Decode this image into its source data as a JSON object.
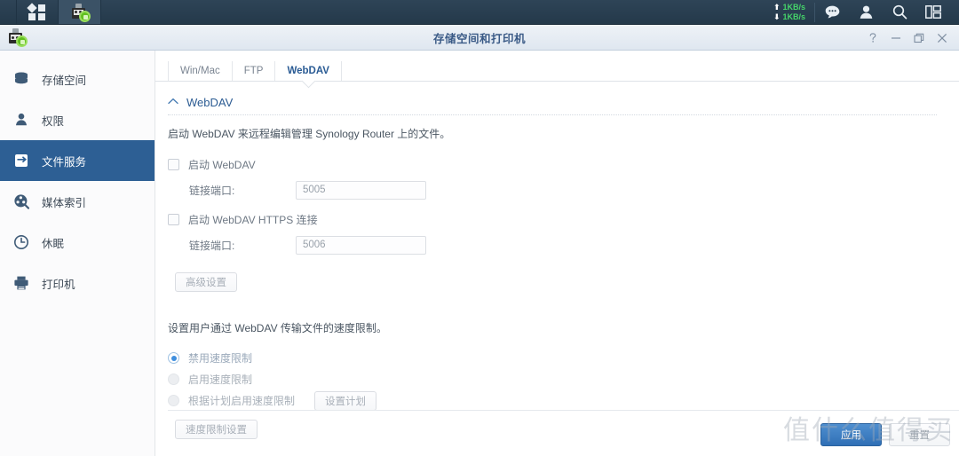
{
  "taskbar": {
    "main_menu_icon": "grid-menu-icon",
    "active_app_icon": "usb-storage-icon",
    "network": {
      "upload": "1KB/s",
      "download": "1KB/s",
      "up_arrow": "⬆",
      "down_arrow": "⬇"
    },
    "icons": [
      {
        "name": "notifications-icon",
        "glyph": "💬"
      },
      {
        "name": "user-account-icon",
        "glyph": "👤"
      },
      {
        "name": "search-icon",
        "glyph": "🔍"
      },
      {
        "name": "widgets-icon",
        "glyph": "▤"
      }
    ]
  },
  "window": {
    "title": "存储空间和打印机",
    "app_icon": "usb-storage-icon",
    "controls": [
      {
        "name": "help-button",
        "label": "?"
      },
      {
        "name": "minimize-button",
        "label": "—"
      },
      {
        "name": "maximize-button",
        "label": "❐"
      },
      {
        "name": "close-button",
        "label": "✕"
      }
    ]
  },
  "sidebar": {
    "items": [
      {
        "label": "存储空间",
        "icon": "storage-stack-icon",
        "active": false
      },
      {
        "label": "权限",
        "icon": "user-permissions-icon",
        "active": false
      },
      {
        "label": "文件服务",
        "icon": "file-service-icon",
        "active": true
      },
      {
        "label": "媒体索引",
        "icon": "media-index-icon",
        "active": false
      },
      {
        "label": "休眠",
        "icon": "hibernation-clock-icon",
        "active": false
      },
      {
        "label": "打印机",
        "icon": "printer-icon",
        "active": false
      }
    ]
  },
  "tabs": [
    {
      "label": "Win/Mac",
      "active": false
    },
    {
      "label": "FTP",
      "active": false
    },
    {
      "label": "WebDAV",
      "active": true
    }
  ],
  "main": {
    "section_title": "WebDAV",
    "collapse_icon": "chevron-up-icon",
    "description": "启动 WebDAV 来远程编辑管理 Synology Router 上的文件。",
    "webdav_checkbox": {
      "label": "启动 WebDAV",
      "checked": false
    },
    "webdav_port": {
      "label": "链接端口:",
      "value": "5005"
    },
    "webdav_https_checkbox": {
      "label": "启动 WebDAV HTTPS 连接",
      "checked": false
    },
    "webdav_https_port": {
      "label": "链接端口:",
      "value": "5006"
    },
    "advanced_button": "高级设置",
    "speed_limit_description": "设置用户通过 WebDAV 传输文件的速度限制。",
    "speed_options": [
      {
        "label": "禁用速度限制",
        "selected": true
      },
      {
        "label": "启用速度限制",
        "selected": false
      },
      {
        "label": "根据计划启用速度限制",
        "selected": false
      }
    ],
    "schedule_button": "设置计划",
    "speed_limit_settings_button": "速度限制设置"
  },
  "footer": {
    "apply_button": "应用",
    "reset_button": "重置"
  },
  "watermark": "值什么值得买",
  "colors": {
    "accent": "#2d5f94",
    "tab_active": "#2a5b94",
    "taskbar": "#24394a",
    "netspeed_green": "#46d46a"
  }
}
